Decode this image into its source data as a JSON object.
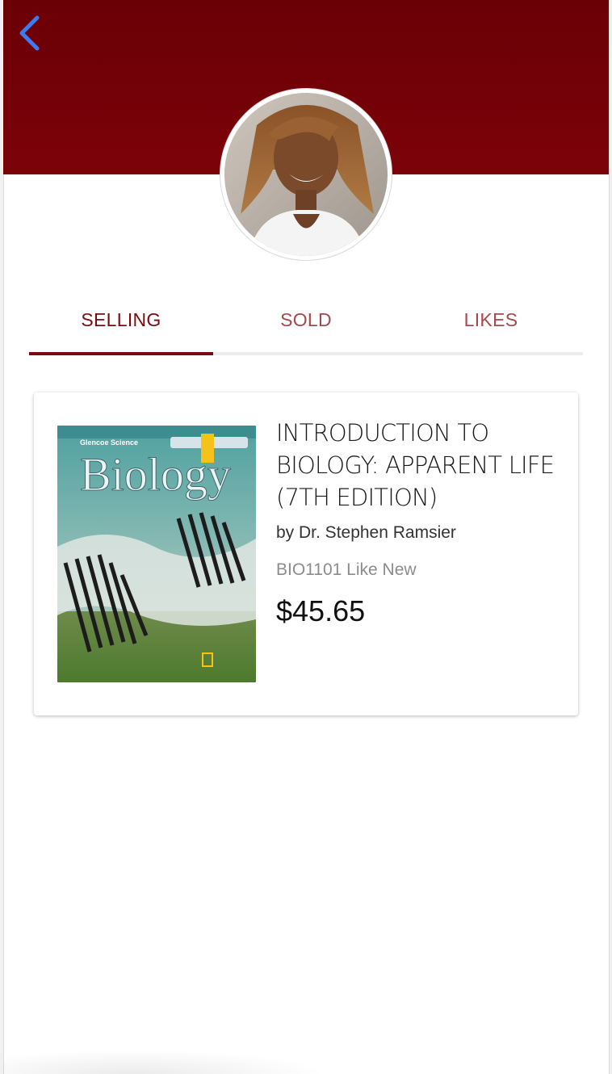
{
  "header": {
    "background_color": "#720006",
    "back_icon": "chevron-left-icon",
    "back_icon_color": "#3b7cf0"
  },
  "profile": {
    "avatar_icon": "profile-photo"
  },
  "tabs": [
    {
      "label": "SELLING",
      "selected": true
    },
    {
      "label": "SOLD",
      "selected": false
    },
    {
      "label": "LIKES",
      "selected": false
    }
  ],
  "listing": {
    "cover_title": "Biology",
    "title": "INTRODUCTION TO BIOLOGY: APPARENT LIFE (7TH EDITION)",
    "author": "by Dr. Stephen Ramsier",
    "meta": "BIO1101 Like New",
    "price": "$45.65"
  },
  "colors": {
    "accent": "#7a0a10",
    "tab_inactive": "#a8474c"
  }
}
